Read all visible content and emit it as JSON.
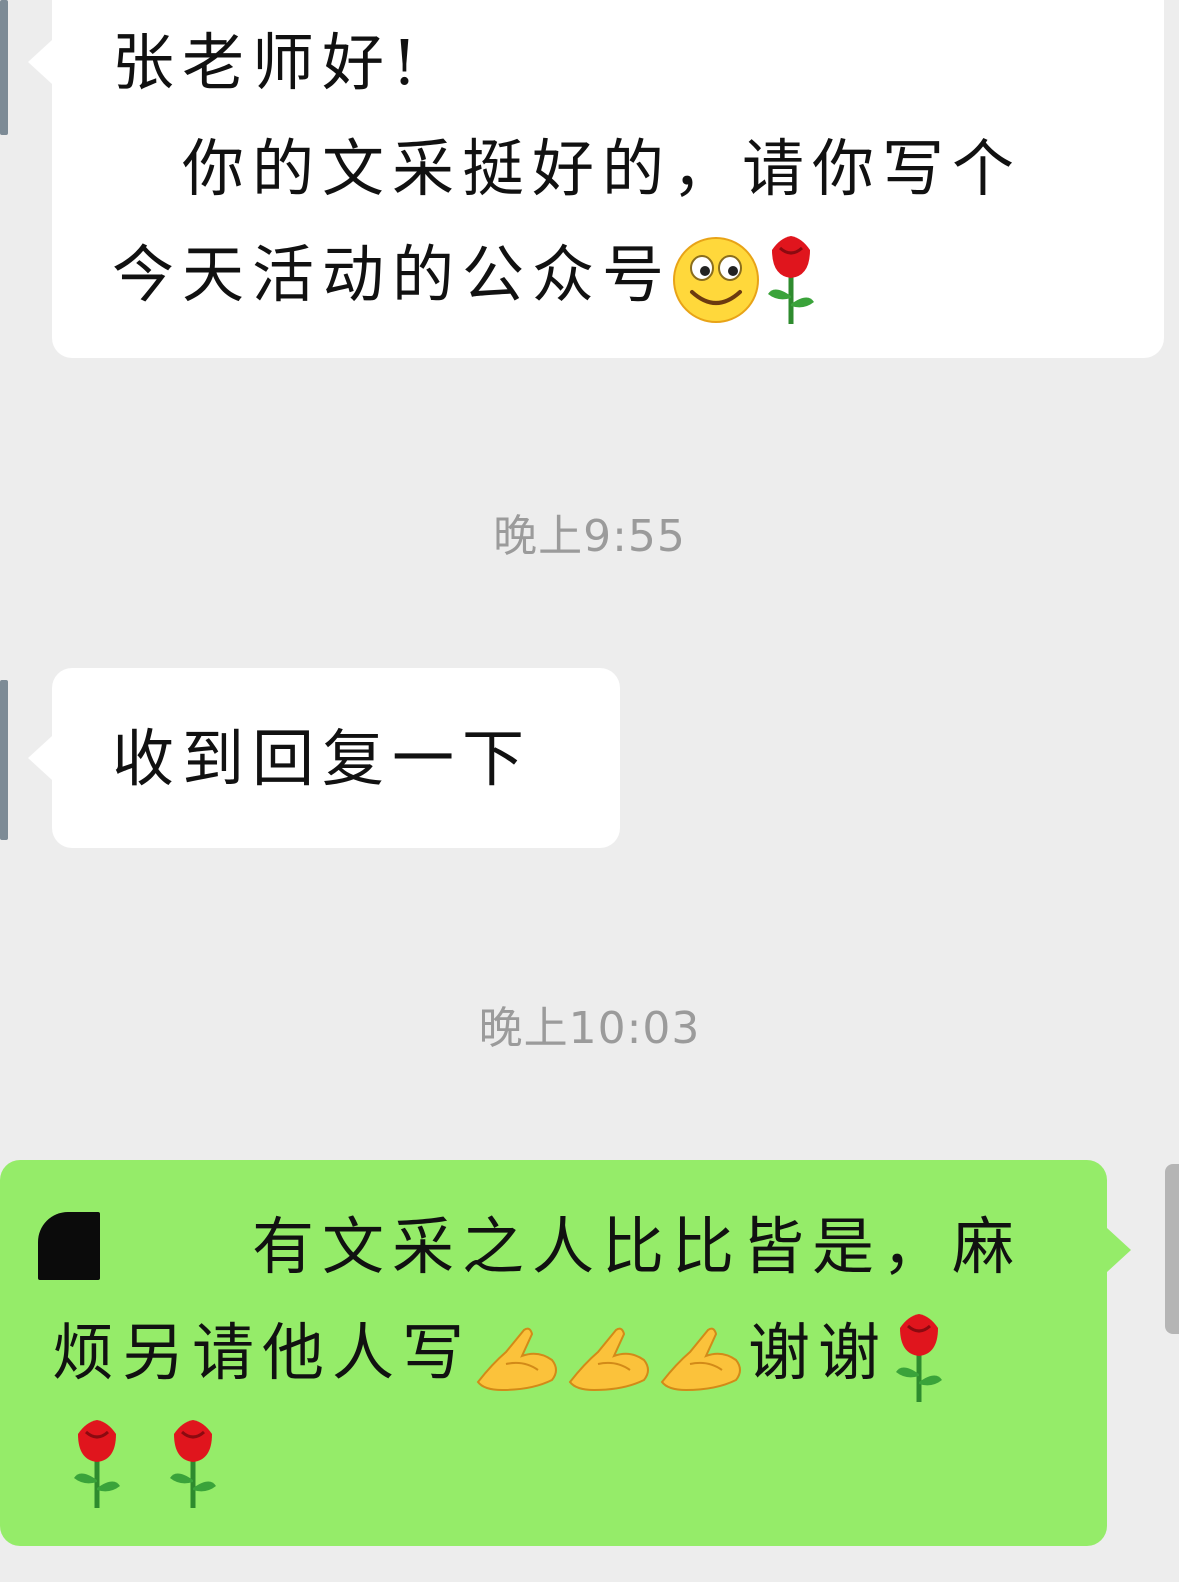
{
  "messages": [
    {
      "direction": "incoming",
      "lines": [
        "张老师好!",
        "　你的文采挺好的，请你写个",
        "今天活动的公众号"
      ],
      "emojis": [
        "smile-emoji",
        "rose-emoji"
      ]
    },
    {
      "direction": "incoming",
      "lines": [
        "收到回复一下"
      ]
    },
    {
      "direction": "outgoing",
      "lines": [
        "　　有文采之人比比皆是，麻",
        "烦另请他人写",
        "谢谢"
      ],
      "emojis": [
        "pray-emoji",
        "pray-emoji",
        "pray-emoji",
        "rose-emoji",
        "rose-emoji",
        "rose-emoji"
      ]
    }
  ],
  "timestamps": [
    "晚上9:55",
    "晚上10:03"
  ],
  "colors": {
    "background": "#ededed",
    "incoming_bubble": "#ffffff",
    "outgoing_bubble": "#95ec69",
    "timestamp_text": "#9b9b9b"
  }
}
